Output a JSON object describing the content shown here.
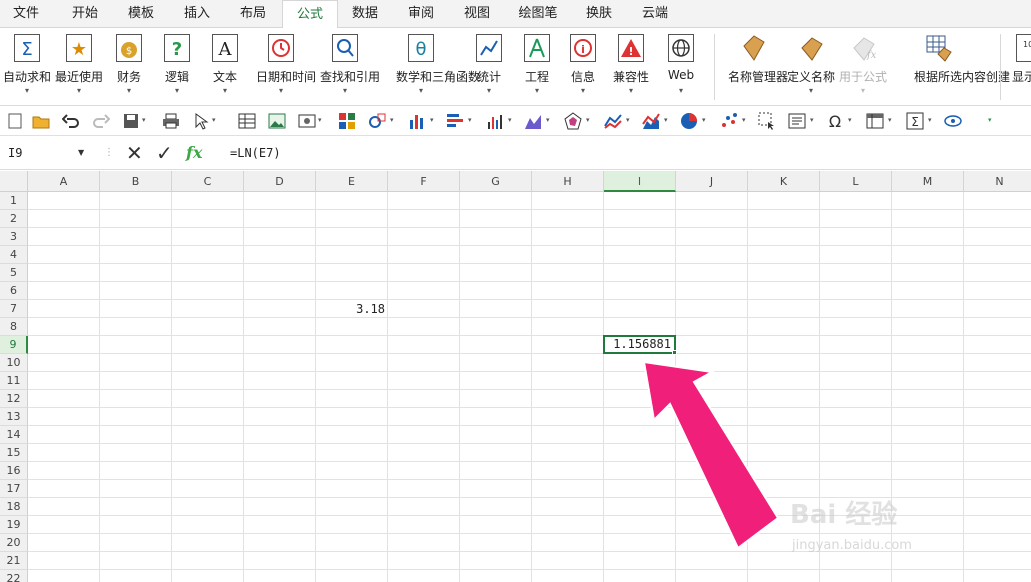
{
  "menu": {
    "tabs": [
      "文件",
      "开始",
      "模板",
      "插入",
      "布局",
      "公式",
      "数据",
      "审阅",
      "视图",
      "绘图笔",
      "换肤",
      "云端"
    ],
    "active": "公式"
  },
  "ribbon": {
    "buttons": [
      {
        "label": "自动求和",
        "icon": "sigma-icon"
      },
      {
        "label": "最近使用",
        "icon": "star-icon"
      },
      {
        "label": "财务",
        "icon": "money-bag-icon"
      },
      {
        "label": "逻辑",
        "icon": "question-icon"
      },
      {
        "label": "文本",
        "icon": "text-a-icon"
      },
      {
        "label": "日期和时间",
        "icon": "clock-icon"
      },
      {
        "label": "查找和引用",
        "icon": "magnifier-icon"
      },
      {
        "label": "数学和三角函数",
        "icon": "theta-icon"
      },
      {
        "label": "统计",
        "icon": "chart-icon"
      },
      {
        "label": "工程",
        "icon": "compass-icon"
      },
      {
        "label": "信息",
        "icon": "info-icon"
      },
      {
        "label": "兼容性",
        "icon": "warning-icon"
      },
      {
        "label": "Web",
        "icon": "globe-icon"
      },
      {
        "label": "名称管理器",
        "icon": "tag-icon"
      },
      {
        "label": "定义名称",
        "icon": "tag-define-icon"
      },
      {
        "label": "用于公式",
        "icon": "tag-fx-icon",
        "disabled": true
      },
      {
        "label": "根据所选内容创建",
        "icon": "grid-tag-icon"
      },
      {
        "label": "显示",
        "icon": "display-icon"
      }
    ]
  },
  "formula_bar": {
    "name_box": "I9",
    "cancel_symbol": "✕",
    "enter_symbol": "✓",
    "fx_symbol": "fx",
    "formula": "=LN(E7)"
  },
  "sheet": {
    "columns": [
      "A",
      "B",
      "C",
      "D",
      "E",
      "F",
      "G",
      "H",
      "I",
      "J",
      "K",
      "L",
      "M",
      "N"
    ],
    "rows": [
      "1",
      "2",
      "3",
      "4",
      "5",
      "6",
      "7",
      "8",
      "9",
      "10",
      "11",
      "12",
      "13",
      "14",
      "15",
      "16",
      "17",
      "18",
      "19",
      "20",
      "21",
      "22"
    ],
    "selected_column": "I",
    "selected_row": "9",
    "cells": {
      "E7": "3.18",
      "I9": "1.156881"
    }
  },
  "watermark": {
    "brand": "Bai",
    "brand2": "经验",
    "url": "jingyan.baidu.com"
  },
  "colors": {
    "accent": "#1f7a3c",
    "arrow": "#f01f7a"
  }
}
